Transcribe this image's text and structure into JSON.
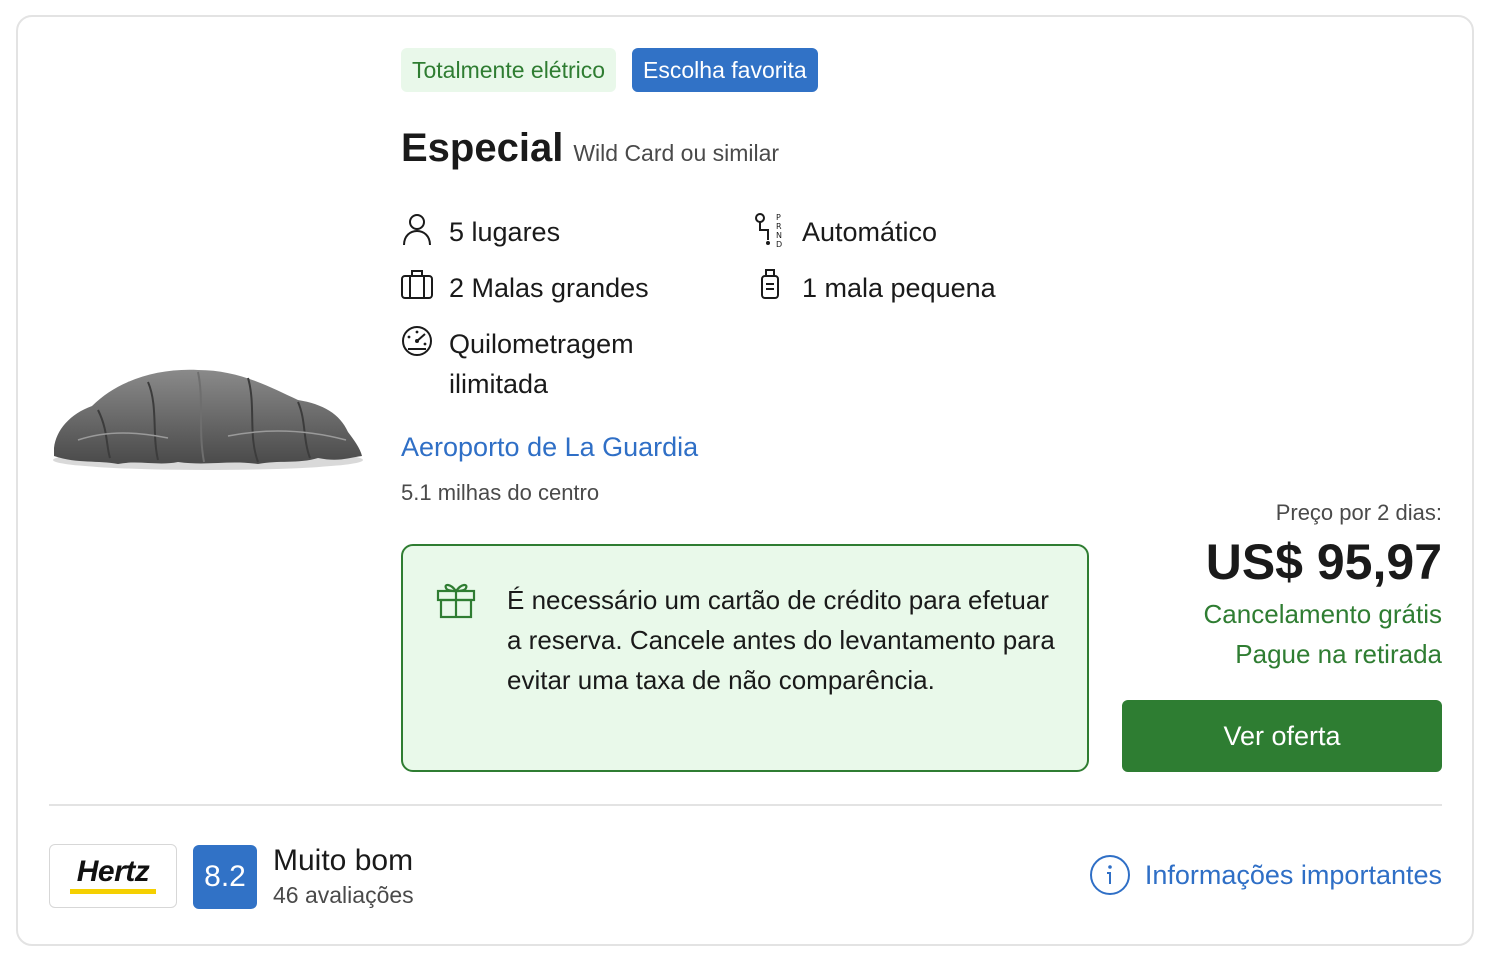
{
  "badges": {
    "electric": "Totalmente elétrico",
    "favorite": "Escolha favorita"
  },
  "car": {
    "category": "Especial",
    "model": "Wild Card ou similar",
    "image_icon": "covered-car-image"
  },
  "features": {
    "seats": "5 lugares",
    "transmission": "Automático",
    "large_bags": "2 Malas grandes",
    "small_bags": "1 mala pequena",
    "mileage_line1": "Quilometragem",
    "mileage_line2": "ilimitada"
  },
  "location": {
    "name": "Aeroporto de La Guardia",
    "distance": "5.1 milhas do centro"
  },
  "notice": {
    "icon": "gift-icon",
    "text": "É necessário um cartão de crédito para efetuar a reserva. Cancele antes do levantamento para evitar uma taxa de não comparência."
  },
  "pricing": {
    "label": "Preço por 2 dias:",
    "price": "US$ 95,97",
    "free_cancel": "Cancelamento grátis",
    "pay_at_pickup": "Pague na retirada",
    "cta": "Ver oferta"
  },
  "supplier": {
    "logo_text": "Hertz",
    "score": "8.2",
    "rating_word": "Muito bom",
    "reviews": "46 avaliações"
  },
  "info": {
    "label": "Informações importantes",
    "icon": "info-icon"
  },
  "colors": {
    "accent_blue": "#3172c6",
    "link_blue": "#2f6fc6",
    "green": "#2e7d32",
    "notice_bg": "#e9f9ea"
  }
}
